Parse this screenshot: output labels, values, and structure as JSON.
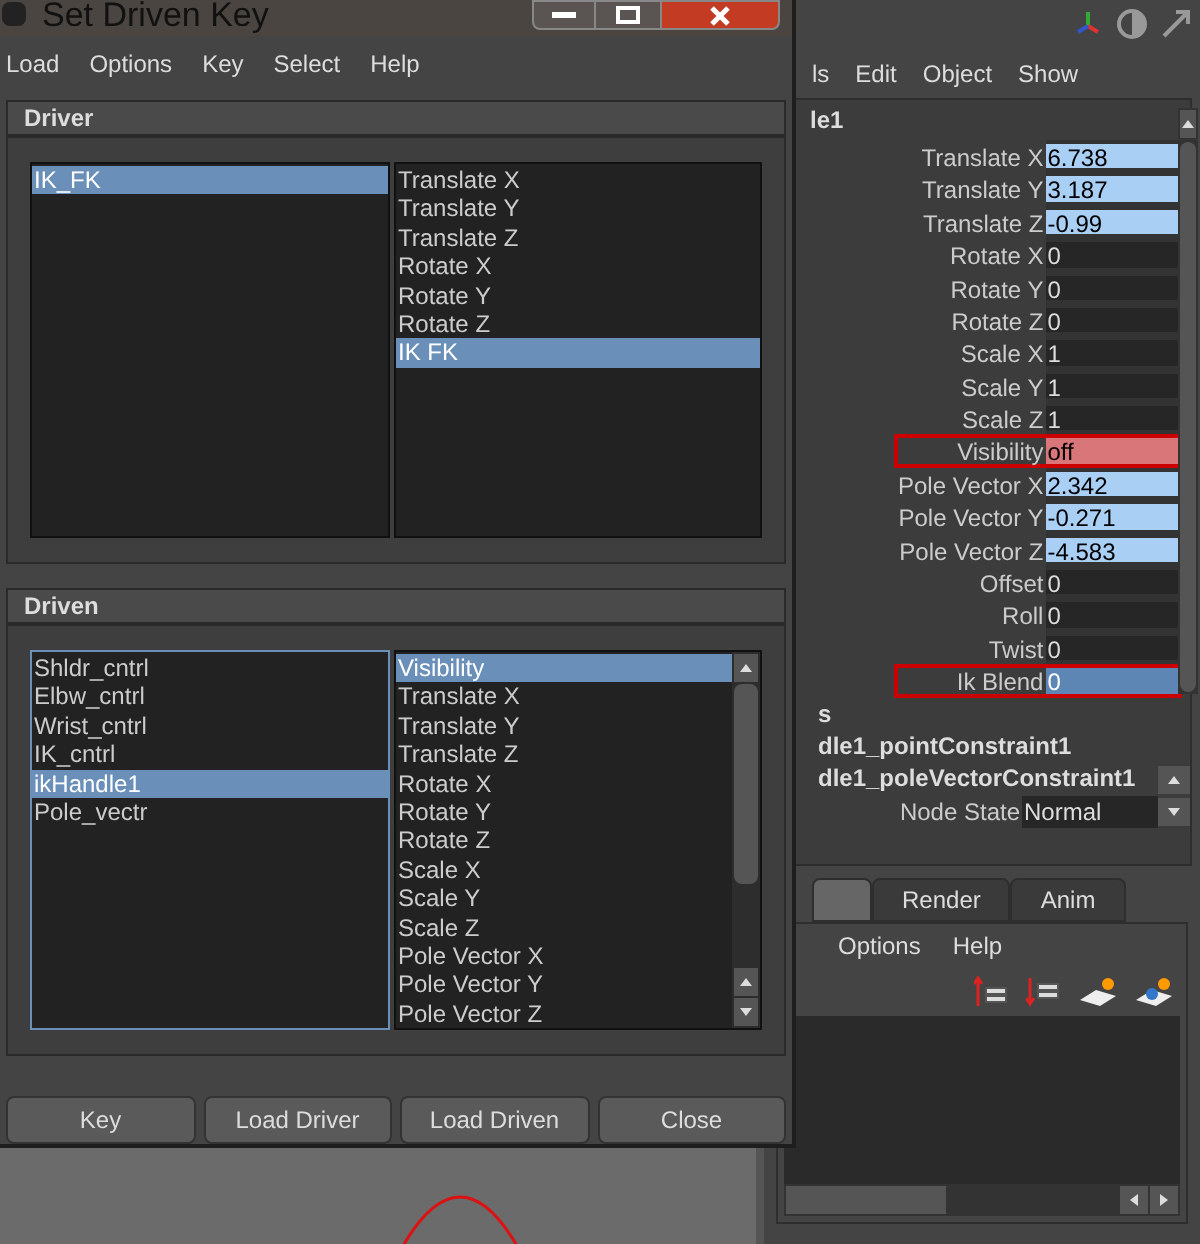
{
  "dialog": {
    "title": "Set Driven Key",
    "menu": [
      "Load",
      "Options",
      "Key",
      "Select",
      "Help"
    ],
    "driver": {
      "header": "Driver",
      "objects": [
        {
          "label": "IK_FK",
          "selected": true
        }
      ],
      "attributes": [
        {
          "label": "Translate X",
          "selected": false
        },
        {
          "label": "Translate Y",
          "selected": false
        },
        {
          "label": "Translate Z",
          "selected": false
        },
        {
          "label": "Rotate X",
          "selected": false
        },
        {
          "label": "Rotate Y",
          "selected": false
        },
        {
          "label": "Rotate Z",
          "selected": false
        },
        {
          "label": "IK FK",
          "selected": true
        }
      ]
    },
    "driven": {
      "header": "Driven",
      "objects": [
        {
          "label": "Shldr_cntrl",
          "selected": false
        },
        {
          "label": "Elbw_cntrl",
          "selected": false
        },
        {
          "label": "Wrist_cntrl",
          "selected": false
        },
        {
          "label": "IK_cntrl",
          "selected": false
        },
        {
          "label": "ikHandle1",
          "selected": true
        },
        {
          "label": "Pole_vectr",
          "selected": false
        }
      ],
      "attributes": [
        {
          "label": "Visibility",
          "selected": true
        },
        {
          "label": "Translate X",
          "selected": false
        },
        {
          "label": "Translate Y",
          "selected": false
        },
        {
          "label": "Translate Z",
          "selected": false
        },
        {
          "label": "Rotate X",
          "selected": false
        },
        {
          "label": "Rotate Y",
          "selected": false
        },
        {
          "label": "Rotate Z",
          "selected": false
        },
        {
          "label": "Scale X",
          "selected": false
        },
        {
          "label": "Scale Y",
          "selected": false
        },
        {
          "label": "Scale Z",
          "selected": false
        },
        {
          "label": "Pole Vector X",
          "selected": false
        },
        {
          "label": "Pole Vector Y",
          "selected": false
        },
        {
          "label": "Pole Vector Z",
          "selected": false
        }
      ]
    },
    "buttons": [
      "Key",
      "Load Driver",
      "Load Driven",
      "Close"
    ]
  },
  "channel_box": {
    "menu": [
      "ls",
      "Edit",
      "Object",
      "Show"
    ],
    "node": "le1",
    "attributes": [
      {
        "label": "Translate X",
        "value": "6.738",
        "kind": "connected",
        "outlined": false
      },
      {
        "label": "Translate Y",
        "value": "3.187",
        "kind": "connected",
        "outlined": false
      },
      {
        "label": "Translate Z",
        "value": "-0.99",
        "kind": "connected",
        "outlined": false
      },
      {
        "label": "Rotate X",
        "value": "0",
        "kind": "normal",
        "outlined": false
      },
      {
        "label": "Rotate Y",
        "value": "0",
        "kind": "normal",
        "outlined": false
      },
      {
        "label": "Rotate Z",
        "value": "0",
        "kind": "normal",
        "outlined": false
      },
      {
        "label": "Scale X",
        "value": "1",
        "kind": "normal",
        "outlined": false
      },
      {
        "label": "Scale Y",
        "value": "1",
        "kind": "normal",
        "outlined": false
      },
      {
        "label": "Scale Z",
        "value": "1",
        "kind": "normal",
        "outlined": false
      },
      {
        "label": "Visibility",
        "value": "off",
        "kind": "keyed",
        "outlined": true
      },
      {
        "label": "Pole Vector X",
        "value": "2.342",
        "kind": "connected",
        "outlined": false
      },
      {
        "label": "Pole Vector Y",
        "value": "-0.271",
        "kind": "connected",
        "outlined": false
      },
      {
        "label": "Pole Vector Z",
        "value": "-4.583",
        "kind": "connected",
        "outlined": false
      },
      {
        "label": "Offset",
        "value": "0",
        "kind": "normal",
        "outlined": false
      },
      {
        "label": "Roll",
        "value": "0",
        "kind": "normal",
        "outlined": false
      },
      {
        "label": "Twist",
        "value": "0",
        "kind": "normal",
        "outlined": false
      },
      {
        "label": "Ik Blend",
        "value": "0",
        "kind": "selected",
        "outlined": true
      }
    ],
    "sections": [
      "s",
      "dle1_pointConstraint1",
      "dle1_poleVectorConstraint1"
    ],
    "node_state": {
      "label": "Node State",
      "value": "Normal"
    },
    "tabs": [
      {
        "selected": true
      },
      {
        "label": "Render",
        "selected": false
      },
      {
        "label": "Anim",
        "selected": false
      }
    ],
    "layer_menu": [
      "Options",
      "Help"
    ]
  }
}
